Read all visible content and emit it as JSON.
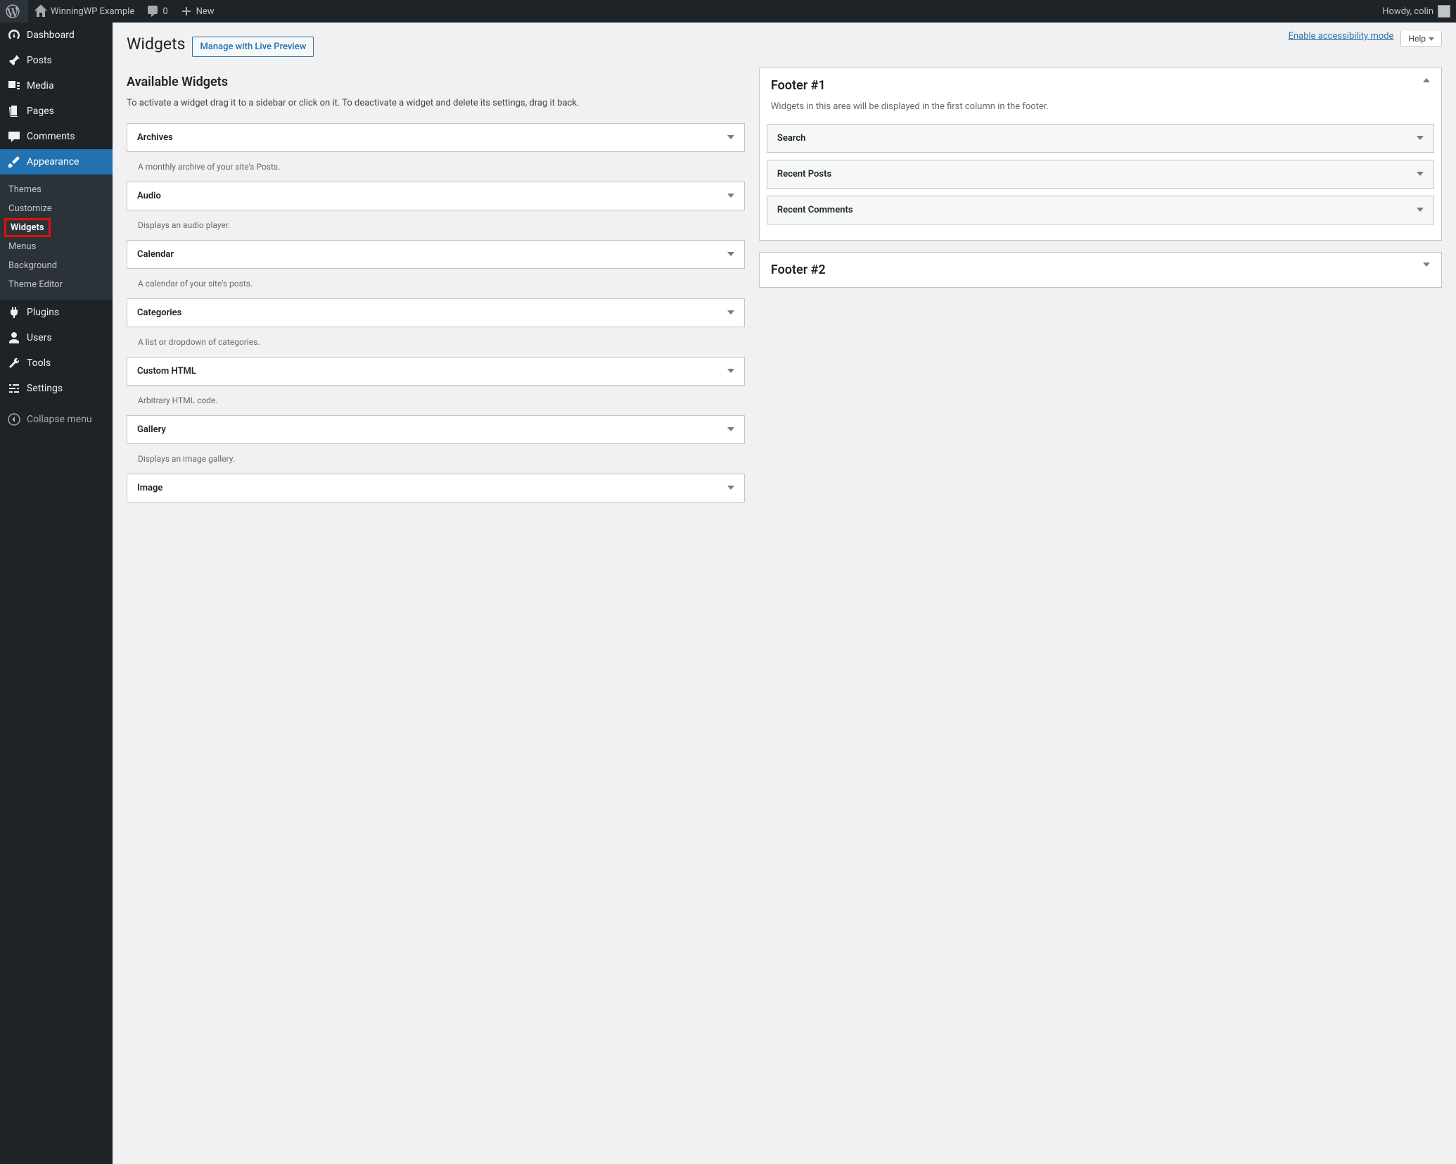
{
  "adminbar": {
    "site_title": "WinningWP Example",
    "comments_count": "0",
    "new_label": "New",
    "howdy": "Howdy, colin"
  },
  "menu": {
    "dashboard": "Dashboard",
    "posts": "Posts",
    "media": "Media",
    "pages": "Pages",
    "comments": "Comments",
    "appearance": "Appearance",
    "plugins": "Plugins",
    "users": "Users",
    "tools": "Tools",
    "settings": "Settings",
    "collapse": "Collapse menu",
    "appearance_sub": {
      "themes": "Themes",
      "customize": "Customize",
      "widgets": "Widgets",
      "menus": "Menus",
      "background": "Background",
      "theme_editor": "Theme Editor"
    }
  },
  "page": {
    "title": "Widgets",
    "live_preview": "Manage with Live Preview",
    "accessibility_link": "Enable accessibility mode",
    "help": "Help",
    "available_title": "Available Widgets",
    "available_desc": "To activate a widget drag it to a sidebar or click on it. To deactivate a widget and delete its settings, drag it back."
  },
  "available_widgets": [
    {
      "name": "Archives",
      "desc": "A monthly archive of your site's Posts."
    },
    {
      "name": "Audio",
      "desc": "Displays an audio player."
    },
    {
      "name": "Calendar",
      "desc": "A calendar of your site's posts."
    },
    {
      "name": "Categories",
      "desc": "A list or dropdown of categories."
    },
    {
      "name": "Custom HTML",
      "desc": "Arbitrary HTML code."
    },
    {
      "name": "Gallery",
      "desc": "Displays an image gallery."
    },
    {
      "name": "Image",
      "desc": ""
    }
  ],
  "sidebar_areas": [
    {
      "title": "Footer #1",
      "desc": "Widgets in this area will be displayed in the first column in the footer.",
      "expanded": true,
      "widgets": [
        "Search",
        "Recent Posts",
        "Recent Comments"
      ]
    },
    {
      "title": "Footer #2",
      "desc": "",
      "expanded": false,
      "widgets": []
    }
  ]
}
